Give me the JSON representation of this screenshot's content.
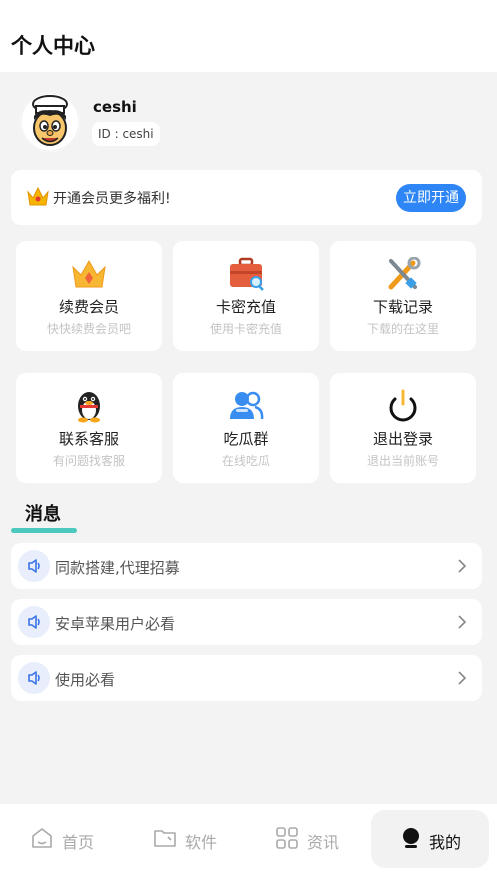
{
  "header": {
    "title": "个人中心"
  },
  "profile": {
    "username": "ceshi",
    "id_prefix": "ID : ",
    "id_value": "ceshi"
  },
  "vip": {
    "text": "开通会员更多福利!",
    "button": "立即开通"
  },
  "features": [
    {
      "title": "续费会员",
      "subtitle": "快快续费会员吧",
      "icon": "crown-icon"
    },
    {
      "title": "卡密充值",
      "subtitle": "使用卡密充值",
      "icon": "briefcase-icon"
    },
    {
      "title": "下载记录",
      "subtitle": "下载的在这里",
      "icon": "tools-icon"
    },
    {
      "title": "联系客服",
      "subtitle": "有问题找客服",
      "icon": "penguin-icon"
    },
    {
      "title": "吃瓜群",
      "subtitle": "在线吃瓜",
      "icon": "group-icon"
    },
    {
      "title": "退出登录",
      "subtitle": "退出当前账号",
      "icon": "power-icon"
    }
  ],
  "messages": {
    "title": "消息",
    "items": [
      {
        "text": "同款搭建,代理招募"
      },
      {
        "text": "安卓苹果用户必看"
      },
      {
        "text": "使用必看"
      }
    ]
  },
  "tabbar": {
    "items": [
      {
        "label": "首页",
        "icon": "home-icon"
      },
      {
        "label": "软件",
        "icon": "folder-icon"
      },
      {
        "label": "资讯",
        "icon": "grid-icon"
      },
      {
        "label": "我的",
        "icon": "user-icon"
      }
    ],
    "active_index": 3
  },
  "colors": {
    "accent": "#2e86f6",
    "underline": "#4dc8bf"
  }
}
